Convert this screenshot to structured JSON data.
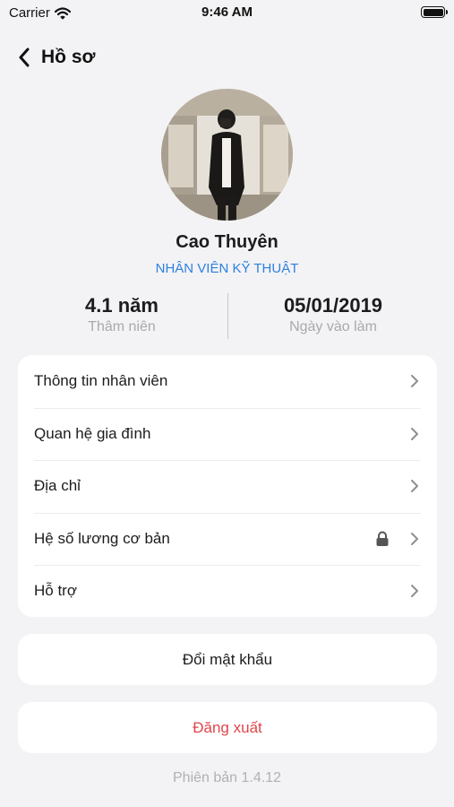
{
  "status_bar": {
    "carrier": "Carrier",
    "time": "9:46 AM",
    "battery_level": 1.0
  },
  "header": {
    "title": "Hồ sơ",
    "back_icon": "chevron-left-icon"
  },
  "profile": {
    "name": "Cao Thuyên",
    "role": "NHÂN VIÊN KỸ THUẬT"
  },
  "stats": {
    "seniority": {
      "value": "4.1 năm",
      "label": "Thâm niên"
    },
    "start_date": {
      "value": "05/01/2019",
      "label": "Ngày vào làm"
    }
  },
  "menu": {
    "items": [
      {
        "label": "Thông tin nhân viên",
        "locked": false
      },
      {
        "label": "Quan hệ gia đình",
        "locked": false
      },
      {
        "label": "Địa chỉ",
        "locked": false
      },
      {
        "label": "Hệ số lương cơ bản",
        "locked": true
      },
      {
        "label": "Hỗ trợ",
        "locked": false
      }
    ]
  },
  "actions": {
    "change_password": "Đổi mật khẩu",
    "logout": "Đăng xuất"
  },
  "footer": {
    "version": "Phiên bản 1.4.12"
  },
  "colors": {
    "accent": "#2f7fe0",
    "danger": "#e0454a",
    "background": "#f3f3f5",
    "card": "#ffffff"
  }
}
